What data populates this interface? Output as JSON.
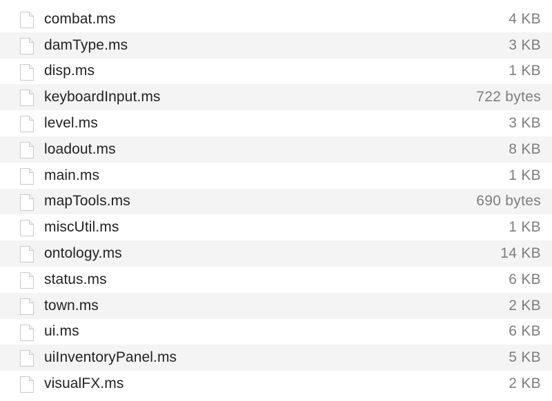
{
  "files": [
    {
      "name": "combat.ms",
      "size": "4 KB",
      "icon": "document-icon"
    },
    {
      "name": "damType.ms",
      "size": "3 KB",
      "icon": "document-icon"
    },
    {
      "name": "disp.ms",
      "size": "1 KB",
      "icon": "document-icon"
    },
    {
      "name": "keyboardInput.ms",
      "size": "722 bytes",
      "icon": "document-icon"
    },
    {
      "name": "level.ms",
      "size": "3 KB",
      "icon": "document-icon"
    },
    {
      "name": "loadout.ms",
      "size": "8 KB",
      "icon": "document-icon"
    },
    {
      "name": "main.ms",
      "size": "1 KB",
      "icon": "document-icon"
    },
    {
      "name": "mapTools.ms",
      "size": "690 bytes",
      "icon": "document-icon"
    },
    {
      "name": "miscUtil.ms",
      "size": "1 KB",
      "icon": "document-icon"
    },
    {
      "name": "ontology.ms",
      "size": "14 KB",
      "icon": "document-icon"
    },
    {
      "name": "status.ms",
      "size": "6 KB",
      "icon": "document-icon"
    },
    {
      "name": "town.ms",
      "size": "2 KB",
      "icon": "document-icon"
    },
    {
      "name": "ui.ms",
      "size": "6 KB",
      "icon": "document-icon"
    },
    {
      "name": "uiInventoryPanel.ms",
      "size": "5 KB",
      "icon": "document-icon"
    },
    {
      "name": "visualFX.ms",
      "size": "2 KB",
      "icon": "document-icon"
    }
  ],
  "colors": {
    "alt_row": "#f4f4f4",
    "name_text": "#222222",
    "size_text": "#7d7d7d"
  }
}
